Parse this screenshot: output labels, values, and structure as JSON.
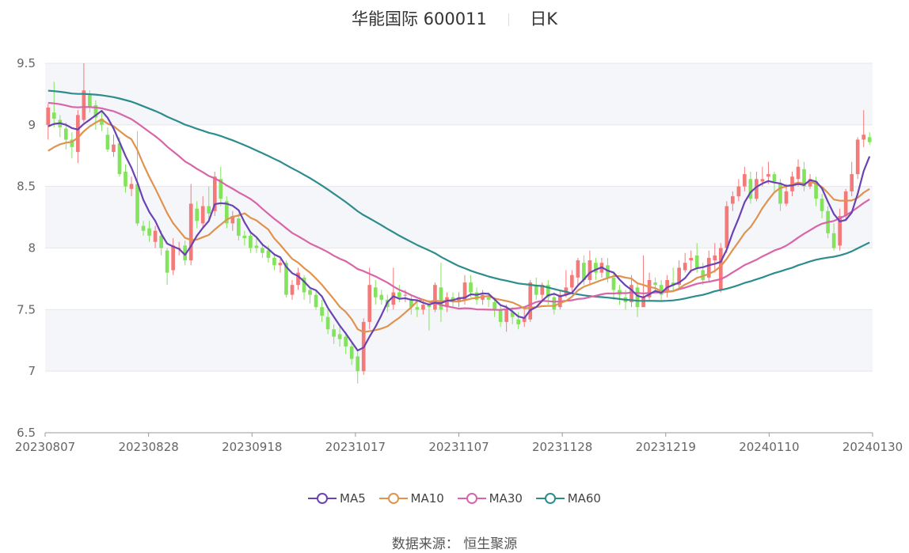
{
  "header": {
    "name": "华能国际",
    "code": "600011",
    "period": "日K"
  },
  "footer": {
    "source": "数据来源：  恒生聚源"
  },
  "colors": {
    "up": "#f47a7a",
    "down": "#84e35c",
    "MA5": "#6a43b3",
    "MA10": "#e0934e",
    "MA30": "#d865a8",
    "MA60": "#2d8c8c"
  },
  "chart_data": {
    "type": "candlestick",
    "title": "华能国际 600011 日K",
    "ylim": [
      6.5,
      9.5
    ],
    "y_ticks": [
      "6.5",
      "7",
      "7.5",
      "8",
      "8.5",
      "9",
      "9.5"
    ],
    "x_ticks": [
      "20230807",
      "20230828",
      "20230918",
      "20231017",
      "20231107",
      "20231128",
      "20231219",
      "20240110",
      "20240130"
    ],
    "legend": [
      "MA5",
      "MA10",
      "MA30",
      "MA60"
    ],
    "candles": [
      [
        9.0,
        9.14,
        8.88,
        9.17
      ],
      [
        9.1,
        9.05,
        8.98,
        9.35
      ],
      [
        9.04,
        8.98,
        8.9,
        9.08
      ],
      [
        8.97,
        8.88,
        8.8,
        9.02
      ],
      [
        8.88,
        8.82,
        8.73,
        8.94
      ],
      [
        8.78,
        9.08,
        8.69,
        9.12
      ],
      [
        9.04,
        9.28,
        9.02,
        9.5
      ],
      [
        9.24,
        9.15,
        9.1,
        9.28
      ],
      [
        9.16,
        9.06,
        8.96,
        9.2
      ],
      [
        9.05,
        9.0,
        8.95,
        9.1
      ],
      [
        8.92,
        8.8,
        8.78,
        8.98
      ],
      [
        8.78,
        8.84,
        8.74,
        8.92
      ],
      [
        8.85,
        8.6,
        8.58,
        8.9
      ],
      [
        8.62,
        8.5,
        8.45,
        8.68
      ],
      [
        8.48,
        8.52,
        8.42,
        8.58
      ],
      [
        8.52,
        8.2,
        8.18,
        8.95
      ],
      [
        8.18,
        8.14,
        8.1,
        8.22
      ],
      [
        8.16,
        8.1,
        8.05,
        8.22
      ],
      [
        8.05,
        8.14,
        8.0,
        8.18
      ],
      [
        8.1,
        8.0,
        7.94,
        8.14
      ],
      [
        7.98,
        7.8,
        7.7,
        8.0
      ],
      [
        7.82,
        8.02,
        7.78,
        8.08
      ],
      [
        8.0,
        8.0,
        7.94,
        8.05
      ],
      [
        8.02,
        7.9,
        7.86,
        8.06
      ],
      [
        7.9,
        8.36,
        7.86,
        8.52
      ],
      [
        8.32,
        8.22,
        8.16,
        8.38
      ],
      [
        8.2,
        8.34,
        8.16,
        8.42
      ],
      [
        8.34,
        8.28,
        8.22,
        8.5
      ],
      [
        8.3,
        8.58,
        8.26,
        8.62
      ],
      [
        8.56,
        8.4,
        8.34,
        8.66
      ],
      [
        8.38,
        8.2,
        8.16,
        8.42
      ],
      [
        8.2,
        8.26,
        8.14,
        8.3
      ],
      [
        8.24,
        8.1,
        8.06,
        8.28
      ],
      [
        8.1,
        8.08,
        8.02,
        8.14
      ],
      [
        8.1,
        8.0,
        7.96,
        8.14
      ],
      [
        8.02,
        8.0,
        7.96,
        8.08
      ],
      [
        8.0,
        7.96,
        7.92,
        8.04
      ],
      [
        7.98,
        7.92,
        7.88,
        8.02
      ],
      [
        7.92,
        7.86,
        7.82,
        7.96
      ],
      [
        7.86,
        7.88,
        7.8,
        7.92
      ],
      [
        7.88,
        7.62,
        7.6,
        7.9
      ],
      [
        7.62,
        7.7,
        7.58,
        7.74
      ],
      [
        7.7,
        7.8,
        7.66,
        7.84
      ],
      [
        7.76,
        7.64,
        7.58,
        7.78
      ],
      [
        7.66,
        7.62,
        7.55,
        7.68
      ],
      [
        7.62,
        7.52,
        7.5,
        7.66
      ],
      [
        7.52,
        7.45,
        7.4,
        7.58
      ],
      [
        7.44,
        7.34,
        7.3,
        7.5
      ],
      [
        7.34,
        7.28,
        7.22,
        7.38
      ],
      [
        7.3,
        7.26,
        7.2,
        7.36
      ],
      [
        7.28,
        7.2,
        7.14,
        7.32
      ],
      [
        7.2,
        7.1,
        7.05,
        7.24
      ],
      [
        7.12,
        7.0,
        6.9,
        7.16
      ],
      [
        7.0,
        7.4,
        6.97,
        7.43
      ],
      [
        7.4,
        7.7,
        7.34,
        7.84
      ],
      [
        7.68,
        7.6,
        7.54,
        7.74
      ],
      [
        7.62,
        7.58,
        7.54,
        7.66
      ],
      [
        7.58,
        7.52,
        7.48,
        7.62
      ],
      [
        7.54,
        7.64,
        7.5,
        7.84
      ],
      [
        7.64,
        7.6,
        7.56,
        7.7
      ],
      [
        7.62,
        7.62,
        7.56,
        7.66
      ],
      [
        7.58,
        7.52,
        7.46,
        7.62
      ],
      [
        7.52,
        7.5,
        7.44,
        7.56
      ],
      [
        7.5,
        7.54,
        7.46,
        7.58
      ],
      [
        7.54,
        7.52,
        7.33,
        7.58
      ],
      [
        7.5,
        7.7,
        7.48,
        7.72
      ],
      [
        7.68,
        7.5,
        7.4,
        7.88
      ],
      [
        7.52,
        7.6,
        7.48,
        7.64
      ],
      [
        7.6,
        7.56,
        7.52,
        7.64
      ],
      [
        7.56,
        7.6,
        7.52,
        7.64
      ],
      [
        7.58,
        7.72,
        7.54,
        7.78
      ],
      [
        7.72,
        7.64,
        7.6,
        7.78
      ],
      [
        7.64,
        7.58,
        7.54,
        7.68
      ],
      [
        7.58,
        7.62,
        7.54,
        7.66
      ],
      [
        7.6,
        7.58,
        7.52,
        7.64
      ],
      [
        7.56,
        7.5,
        7.44,
        7.6
      ],
      [
        7.5,
        7.4,
        7.36,
        7.54
      ],
      [
        7.4,
        7.5,
        7.32,
        7.54
      ],
      [
        7.48,
        7.44,
        7.38,
        7.52
      ],
      [
        7.42,
        7.38,
        7.34,
        7.48
      ],
      [
        7.4,
        7.44,
        7.36,
        7.5
      ],
      [
        7.42,
        7.72,
        7.4,
        7.74
      ],
      [
        7.7,
        7.62,
        7.58,
        7.76
      ],
      [
        7.62,
        7.7,
        7.58,
        7.72
      ],
      [
        7.7,
        7.6,
        7.54,
        7.74
      ],
      [
        7.6,
        7.5,
        7.46,
        7.64
      ],
      [
        7.52,
        7.62,
        7.5,
        7.66
      ],
      [
        7.62,
        7.68,
        7.6,
        7.82
      ],
      [
        7.68,
        7.78,
        7.64,
        7.82
      ],
      [
        7.76,
        7.9,
        7.7,
        7.92
      ],
      [
        7.88,
        7.74,
        7.7,
        7.94
      ],
      [
        7.74,
        7.9,
        7.7,
        7.98
      ],
      [
        7.88,
        7.8,
        7.74,
        7.92
      ],
      [
        7.8,
        7.88,
        7.76,
        7.92
      ],
      [
        7.86,
        7.76,
        7.72,
        7.92
      ],
      [
        7.76,
        7.66,
        7.58,
        7.8
      ],
      [
        7.66,
        7.62,
        7.54,
        7.7
      ],
      [
        7.6,
        7.56,
        7.5,
        7.66
      ],
      [
        7.56,
        7.7,
        7.52,
        7.78
      ],
      [
        7.68,
        7.52,
        7.44,
        7.72
      ],
      [
        7.52,
        7.6,
        7.58,
        7.94
      ],
      [
        7.6,
        7.74,
        7.58,
        7.8
      ],
      [
        7.72,
        7.7,
        7.64,
        7.76
      ],
      [
        7.7,
        7.62,
        7.58,
        7.74
      ],
      [
        7.64,
        7.74,
        7.6,
        7.78
      ],
      [
        7.72,
        7.7,
        7.64,
        7.84
      ],
      [
        7.7,
        7.84,
        7.66,
        7.9
      ],
      [
        7.82,
        7.88,
        7.8,
        7.96
      ],
      [
        7.9,
        7.92,
        7.8,
        7.98
      ],
      [
        7.94,
        7.84,
        7.8,
        8.04
      ],
      [
        7.82,
        7.74,
        7.7,
        7.88
      ],
      [
        7.76,
        7.92,
        7.72,
        7.98
      ],
      [
        7.9,
        7.94,
        7.8,
        8.04
      ],
      [
        7.66,
        8.0,
        7.64,
        8.04
      ],
      [
        8.0,
        8.34,
        7.96,
        8.38
      ],
      [
        8.36,
        8.42,
        8.3,
        8.46
      ],
      [
        8.42,
        8.5,
        8.38,
        8.56
      ],
      [
        8.5,
        8.6,
        8.46,
        8.66
      ],
      [
        8.56,
        8.4,
        8.36,
        8.62
      ],
      [
        8.4,
        8.56,
        8.38,
        8.62
      ],
      [
        8.54,
        8.56,
        8.5,
        8.66
      ],
      [
        8.58,
        8.6,
        8.52,
        8.7
      ],
      [
        8.6,
        8.54,
        8.46,
        8.62
      ],
      [
        8.52,
        8.36,
        8.3,
        8.56
      ],
      [
        8.36,
        8.46,
        8.34,
        8.52
      ],
      [
        8.46,
        8.58,
        8.42,
        8.62
      ],
      [
        8.56,
        8.66,
        8.5,
        8.72
      ],
      [
        8.64,
        8.5,
        8.46,
        8.7
      ],
      [
        8.5,
        8.56,
        8.48,
        8.6
      ],
      [
        8.54,
        8.4,
        8.34,
        8.58
      ],
      [
        8.4,
        8.3,
        8.24,
        8.44
      ],
      [
        8.3,
        8.12,
        8.08,
        8.34
      ],
      [
        8.12,
        8.0,
        7.98,
        8.2
      ],
      [
        8.02,
        8.26,
        7.98,
        8.32
      ],
      [
        8.26,
        8.46,
        8.22,
        8.48
      ],
      [
        8.46,
        8.6,
        8.42,
        8.7
      ],
      [
        8.6,
        8.88,
        8.56,
        8.9
      ],
      [
        8.88,
        8.92,
        8.82,
        9.12
      ],
      [
        8.9,
        8.86,
        8.84,
        8.94
      ]
    ]
  }
}
